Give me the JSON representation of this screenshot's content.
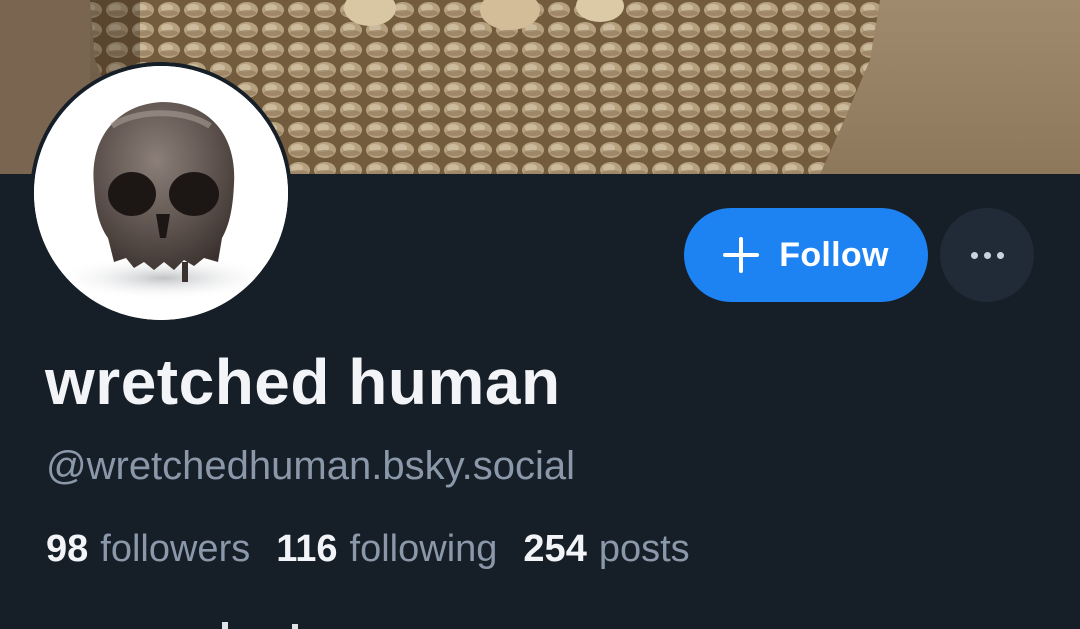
{
  "profile": {
    "display_name": "wretched human",
    "handle": "@wretchedhuman.bsky.social",
    "banner_icon": "catacomb-skulls-photo",
    "avatar_icon": "skull-photo"
  },
  "actions": {
    "follow_label": "Follow",
    "follow_icon": "plus-icon",
    "more_icon": "ellipsis-icon"
  },
  "stats": {
    "followers_count": "98",
    "followers_label": "followers",
    "following_count": "116",
    "following_label": "following",
    "posts_count": "254",
    "posts_label": "posts"
  },
  "colors": {
    "background": "#161e27",
    "accent": "#1d83f2",
    "muted_text": "#8a98aa",
    "primary_text": "#f2f4f7"
  }
}
